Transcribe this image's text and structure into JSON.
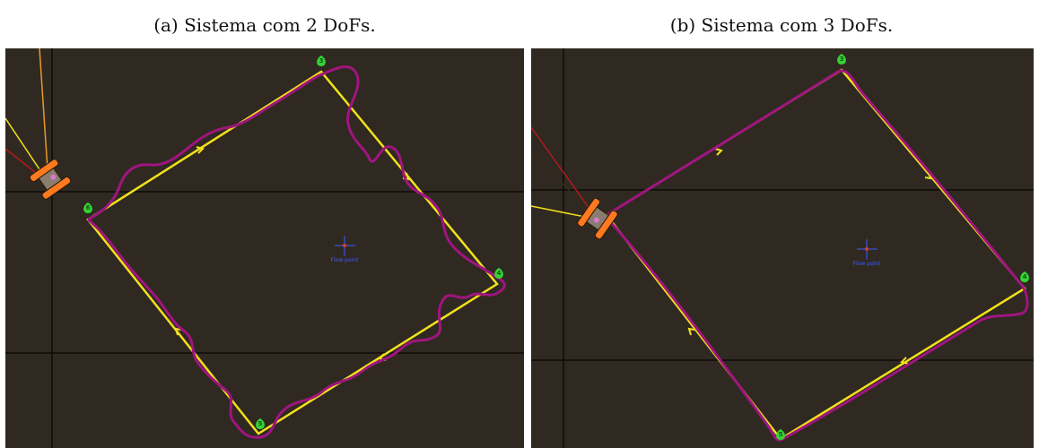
{
  "captions": {
    "a": "(a) Sistema com 2 DoFs.",
    "b": "(b) Sistema com 3 DoFs."
  },
  "map": {
    "background": "#2f2921",
    "grid_color": "#0e0b08",
    "reference_path_color": "#f2e11c",
    "actual_path_color": "#a0157f",
    "waypoint_color": "#33d433",
    "robot_color": "#ff7a1e",
    "center_marker_color": "#3f5bff",
    "center_marker_icon": "crosshair-icon",
    "waypoint_icon": "map-pin-icon",
    "robot_icon": "tracked-robot-icon"
  },
  "panels": [
    {
      "id": "2dof",
      "center_label": "Flow point",
      "waypoints": [
        {
          "label": "3"
        },
        {
          "label": "4"
        },
        {
          "label": "5"
        },
        {
          "label": "6"
        }
      ]
    },
    {
      "id": "3dof",
      "center_label": "Flow point",
      "waypoints": [
        {
          "label": "3"
        },
        {
          "label": "4"
        },
        {
          "label": "5"
        }
      ]
    }
  ]
}
